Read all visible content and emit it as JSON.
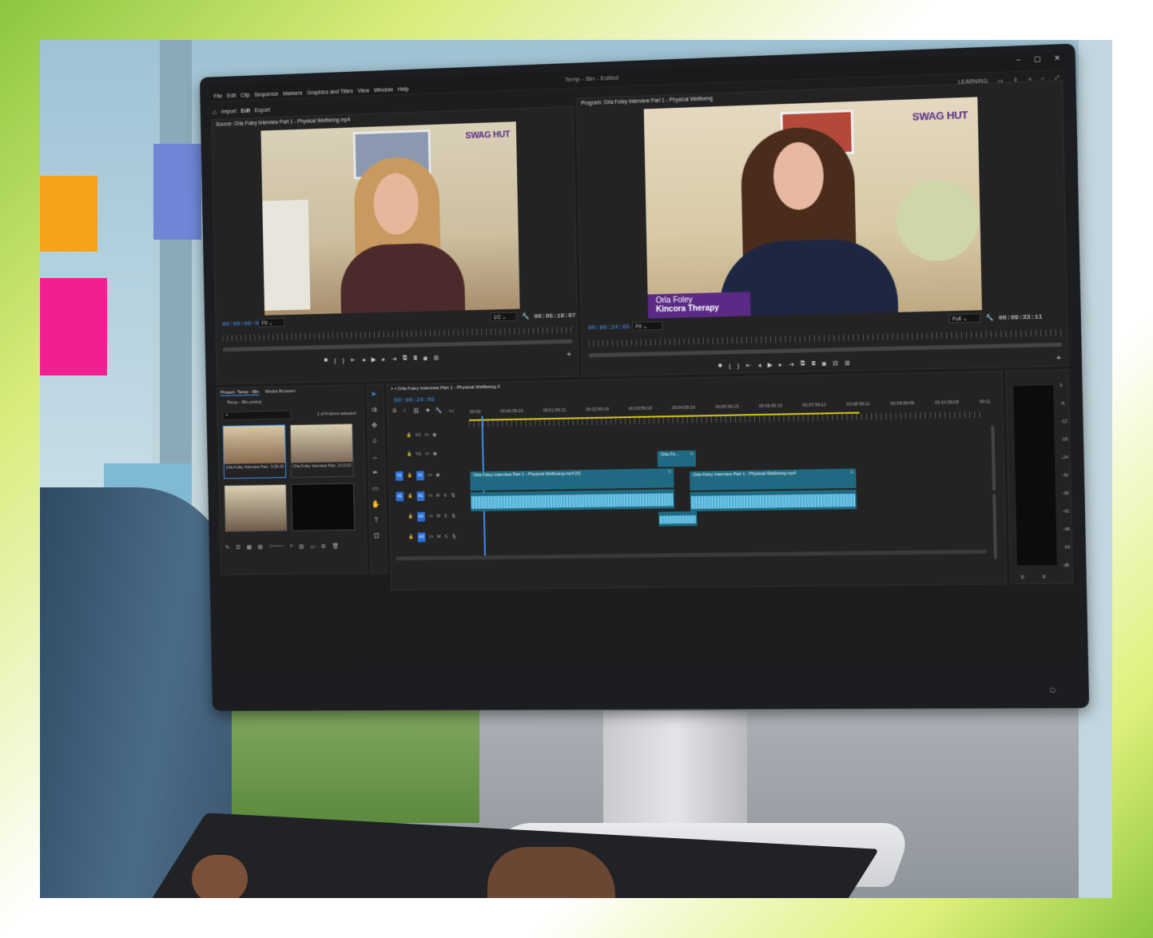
{
  "app": {
    "document_title": "Temp - Bin - Edited",
    "menu": [
      "File",
      "Edit",
      "Clip",
      "Sequence",
      "Markers",
      "Graphics and Titles",
      "View",
      "Window",
      "Help"
    ],
    "workspaces": [
      "Import",
      "Edit",
      "Export"
    ],
    "active_workspace": "Edit",
    "learning_label": "LEARNING"
  },
  "source_monitor": {
    "title": "Source: Orla Foley Interview Part 1 - Physical Wellbeing.mp4",
    "timecode_current": "00:00:00:00",
    "fit": "Fit",
    "resolution": "1/2",
    "duration": "00:05:18:07",
    "logo": "SWAG HUT"
  },
  "program_monitor": {
    "title": "Program: Orla Foley Interview Part 1 - Physical Wellbeing",
    "timecode_current": "00:00:24:05",
    "fit": "Fit",
    "resolution": "Full",
    "duration": "00:09:33:11",
    "logo": "SWAG HUT",
    "lower_third_name": "Orla Foley",
    "lower_third_company": "Kincora Therapy"
  },
  "project_panel": {
    "tab_project": "Project: Temp - Bin",
    "tab_media": "Media Browser",
    "file": "Temp - Bin.prproj",
    "selection_info": "1 of 6 items selected",
    "items": [
      {
        "name": "Orla Foley Interview Part...",
        "duration": "5:59:18"
      },
      {
        "name": "Orla Foley Interview Part...",
        "duration": "5:13:02"
      },
      {
        "name": "",
        "duration": ""
      },
      {
        "name": "",
        "duration": ""
      }
    ]
  },
  "timeline": {
    "sequence_name": "Orla Foley Interview Part 1 - Physical Wellbeing",
    "timecode": "00:00:24:05",
    "ruler_labels": [
      ":00:00",
      "00:00:59:22",
      "00:01:59:21",
      "00:02:59:19",
      "00:03:59:18",
      "00:04:59:16",
      "00:05:59:15",
      "00:06:59:13",
      "00:07:59:12",
      "00:08:59:11",
      "00:09:59:09",
      "00:10:59:08",
      "00:11"
    ],
    "video_tracks": [
      "V3",
      "V2",
      "V1"
    ],
    "audio_tracks": [
      "A1",
      "A2",
      "A3"
    ],
    "source_patch_video": "V1",
    "source_patch_audio": "A1",
    "track_controls": {
      "mute": "M",
      "solo": "S"
    },
    "clips": {
      "v2_title": "Orla Fo...",
      "v1_clip_a": "Orla Foley Interview Part 1 - Physical Wellbeing.mp4 [V]",
      "v1_clip_b": "Orla Foley Interview Part 1 - Physical Wellbeing.mp4",
      "fx": "fx"
    }
  },
  "audio_meter": {
    "scale": [
      "0",
      "-6",
      "-12",
      "-18",
      "-24",
      "-30",
      "-36",
      "-42",
      "-48",
      "-54",
      "dB"
    ],
    "channels": [
      "S",
      "S"
    ]
  },
  "colors": {
    "accent_blue": "#3f8ff0",
    "clip_teal": "#1f6a82",
    "lower_third_purple": "#5a2a86",
    "frame_green": "#8cc63f"
  }
}
